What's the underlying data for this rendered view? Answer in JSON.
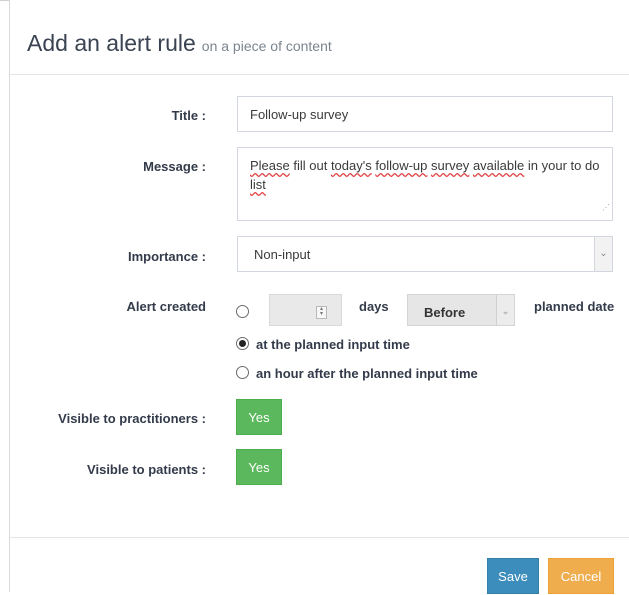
{
  "dialog": {
    "title": "Add an alert rule",
    "subtitle": "on a piece of content"
  },
  "form": {
    "title_label": "Title :",
    "title_value": "Follow-up survey",
    "message_label": "Message :",
    "message_words": [
      "Please",
      " fill out ",
      "today's",
      " ",
      "follow-up",
      " ",
      "survey",
      " ",
      "available",
      " in your to do ",
      "list"
    ],
    "importance_label": "Importance :",
    "importance_value": "Non-input",
    "alert_created_label": "Alert created",
    "days_text": "days",
    "before_value": "Before",
    "planned_date_text": "planned date",
    "option_planned_time": "at the planned input time",
    "option_hour_after": "an hour after the planned input time",
    "visible_practitioners_label": "Visible to practitioners :",
    "visible_practitioners_value": "Yes",
    "visible_patients_label": "Visible to patients :",
    "visible_patients_value": "Yes"
  },
  "footer": {
    "save_label": "Save",
    "cancel_label": "Cancel"
  },
  "colors": {
    "primary": "#3c8dbc",
    "success": "#5cb85c",
    "warning": "#f0ad4e"
  },
  "icons": {
    "spinner": "spinner-arrows-icon",
    "chevron": "chevron-down-icon",
    "resize": "resize-grip-icon"
  }
}
